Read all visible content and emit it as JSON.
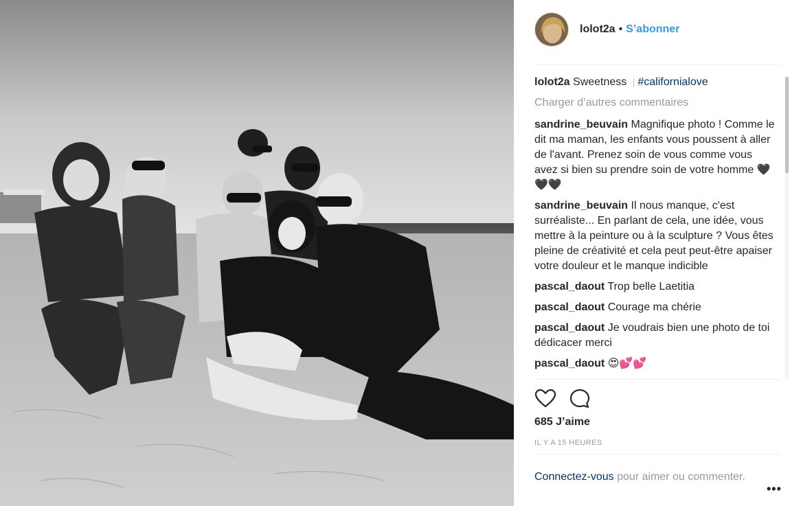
{
  "post": {
    "username": "lolot2a",
    "follow_label": "S’abonner",
    "caption_text": "Sweetness",
    "caption_separator": "|",
    "caption_hashtag": "#californialove",
    "load_more_label": "Charger d’autres commentaires",
    "comments": [
      {
        "author": "sandrine_beuvain",
        "text": "Magnifique photo ! Comme le dit ma maman, les enfants vous poussent à aller de l'avant. Prenez soin de vous comme vous avez si bien su prendre soin de votre homme 🖤🖤🖤"
      },
      {
        "author": "sandrine_beuvain",
        "text": "Il nous manque, c'est surréaliste... En parlant de cela, une idée, vous mettre à la peinture ou à la sculpture ? Vous êtes pleine de créativité et cela peut peut-être apaiser votre douleur et le manque indicible"
      },
      {
        "author": "pascal_daout",
        "text": "Trop belle Laetitia"
      },
      {
        "author": "pascal_daout",
        "text": "Courage ma chérie"
      },
      {
        "author": "pascal_daout",
        "text": "Je voudrais bien une photo de toi dédicacer merci"
      },
      {
        "author": "pascal_daout",
        "text": "😍💕💕"
      }
    ],
    "likes_label": "685 J’aime",
    "timestamp": "IL Y A 15 HEURES",
    "login_link": "Connectez-vous",
    "login_text": " pour aimer ou commenter.",
    "more_label": "•••",
    "icons": {
      "like": "heart-icon",
      "comment": "comment-bubble-icon",
      "options": "more-options-icon"
    },
    "colors": {
      "accent": "#3897f0",
      "link": "#003569",
      "muted": "#999999"
    }
  }
}
